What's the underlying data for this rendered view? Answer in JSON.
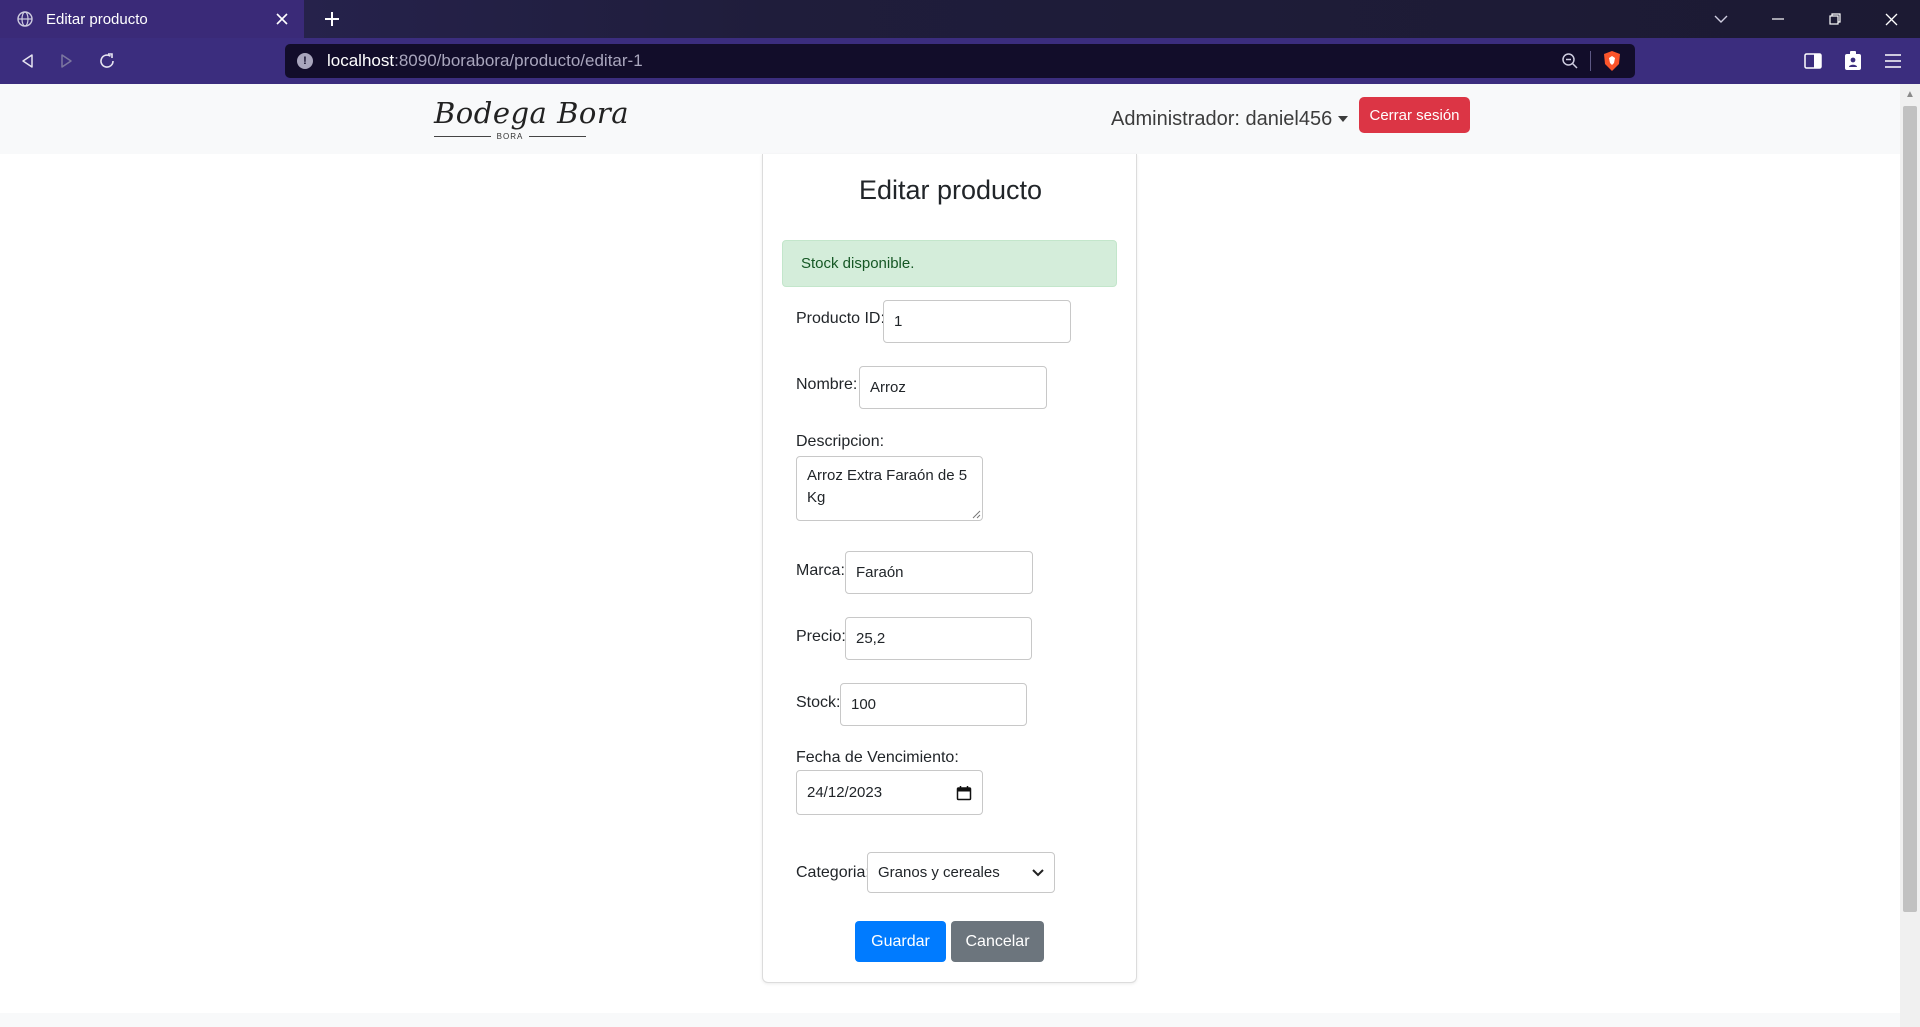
{
  "browser": {
    "tab_title": "Editar producto",
    "url_host": "localhost",
    "url_path": ":8090/borabora/producto/editar-1"
  },
  "site": {
    "logo_text": "Bodega Bora",
    "logo_subtext": "BORA",
    "admin_label": "Administrador: daniel456",
    "logout_label": "Cerrar sesión"
  },
  "form": {
    "title": "Editar producto",
    "alert": "Stock disponible.",
    "producto_id": {
      "label": "Producto ID:",
      "value": "1"
    },
    "nombre": {
      "label": "Nombre:",
      "value": "Arroz"
    },
    "descripcion": {
      "label": "Descripcion:",
      "value": "Arroz Extra Faraón de 5 Kg"
    },
    "marca": {
      "label": "Marca:",
      "value": "Faraón"
    },
    "precio": {
      "label": "Precio:",
      "value": "25,2"
    },
    "stock": {
      "label": "Stock:",
      "value": "100"
    },
    "vencimiento": {
      "label": "Fecha de Vencimiento:",
      "value": "24/12/2023"
    },
    "categoria": {
      "label": "Categoria:",
      "value": "Granos y cereales"
    },
    "save_label": "Guardar",
    "cancel_label": "Cancelar"
  },
  "colors": {
    "primary": "#007bff",
    "secondary": "#6c757d",
    "danger": "#dc3545",
    "success_bg": "#d4edda",
    "browser_toolbar": "#3b2d7e"
  }
}
